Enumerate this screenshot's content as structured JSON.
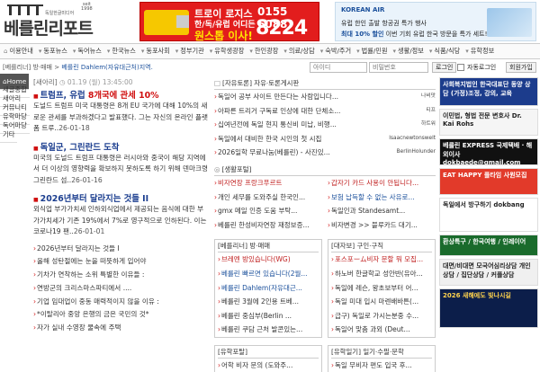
{
  "header": {
    "logo": {
      "since": "seit\n1998",
      "tag": "독일한글미디어",
      "name": "베를린리포트"
    },
    "move_ad": {
      "line1": "트로이 로지스",
      "line2": "한/독/유럽 어디든",
      "line3": "원스톱 이사!",
      "phone1": "0155 6088",
      "phone2": "8224"
    },
    "air_ad": {
      "brand": "KOREAN AIR",
      "line1": "유럽 한인 출발 항공권 특가 행사",
      "line2_prefix": "최대 10% 할인",
      "line2_suffix": " 이번 기회 유럽 한국 방문을 특가 세트!"
    }
  },
  "nav": [
    {
      "icon": "home-icon",
      "label": "이용안내"
    },
    {
      "icon": "chevron-down-icon",
      "label": "동포뉴스"
    },
    {
      "icon": "chevron-down-icon",
      "label": "독어뉴스"
    },
    {
      "icon": "chevron-down-icon",
      "label": "한국뉴스"
    },
    {
      "icon": "chevron-down-icon",
      "label": "동포사회"
    },
    {
      "icon": "chevron-down-icon",
      "label": "정부기관"
    },
    {
      "icon": "chevron-down-icon",
      "label": "유학생광장"
    },
    {
      "icon": "chevron-down-icon",
      "label": "한인광장"
    },
    {
      "icon": "chevron-down-icon",
      "label": "의료/상담"
    },
    {
      "icon": "chevron-down-icon",
      "label": "숙박/주거"
    },
    {
      "icon": "chevron-down-icon",
      "label": "법률/민원"
    },
    {
      "icon": "chevron-down-icon",
      "label": "생활/정보"
    },
    {
      "icon": "chevron-down-icon",
      "label": "식품/식당"
    },
    {
      "icon": "chevron-down-icon",
      "label": "유학정보"
    }
  ],
  "crumb": {
    "prefix": "[베를리너] 방·매매",
    "sep": " > ",
    "current": "베를린 Dahlem(자유대근처)지역.",
    "search_placeholder": "아이디",
    "password_placeholder": "비밀번호",
    "login_label": "로그인",
    "auto_login_label": "자동로그인",
    "signup_label": "회원가입"
  },
  "left_sidebar": [
    "Home",
    "새글종합",
    "새아리",
    "커뮤니티",
    "유학마당",
    "독어마당",
    "기타"
  ],
  "main": {
    "lead_head": "[새아리]",
    "lead_time": "◷ 01.19 (월) 13:45:00",
    "stories": [
      {
        "title_prefix": "트럼프, 유럽 ",
        "title_num": "8개국에 관세 10%",
        "body": "도널드 트럼프 미국 대통령은 8개 EU 국가에 대해 10%의 새로운 관세를 부과하겠다고 발표했다. 그는 자신의 온라인 플랫폼 트루..",
        "date": "26-01-18"
      },
      {
        "title_prefix": "독일군, 그린란드 도착",
        "title_num": "",
        "body": "미국의 도널드 트럼프 대통령은 러시아와 중국이 해당 지역에서 더 이상의 영향력을 확보하지 못하도록 하기 위해 덴마크령 그린란드 섬..",
        "date": "26-01-16"
      },
      {
        "title_prefix": "2026년부터 달라지는 것들 II",
        "title_num": "",
        "body": "외식업 부가가치세 인하외식업에서 제공되는 음식에 대한 부가가치세가 기존 19%에서 7%로 영구적으로 인하된다. 이는 코로나19 팬..",
        "date": "26-01-01"
      }
    ],
    "headlines": [
      "2026년부터 달라지는 것들 I",
      "올해 성탄절에는 눈을 떠뜻하게 입어야",
      "기차가 연착하는 소위 특별한 이유들 :",
      "연방군의 크리스마스파티에서 ....",
      "기업 임대업이 중동 매력적이지 않을 이유 :",
      "*이탈리아 중앙 은행의 금은 국민의 것*",
      "자가 실내 수영장 물속에 주택"
    ]
  },
  "center": {
    "free_head": "[자유토론] 자유·토론게시판",
    "free_rows": [
      {
        "text": "독일어 공부 사이트 만든다는 사람입니다...",
        "src": "나비맛"
      },
      {
        "text": "아파른 트리거 구독료 인상에 대한 단체소...",
        "src": "티프"
      },
      {
        "text": "십여년전에 독일 현지 통신비 미납, 비행...",
        "src": "하트워"
      },
      {
        "text": "독일에서 대비한 한국 시인의 첫 시집",
        "src": "Isaacnewtonswelt"
      },
      {
        "text": "2026일학 무료나눔(베를린) - 사진있...",
        "src": "BerlinHolunder"
      }
    ],
    "life_head": "[생활포털]",
    "life_left": [
      {
        "text": "비자연장 프랑크푸르트",
        "color": "red"
      },
      {
        "text": "개인 세무를 도와주실 한국인...",
        "color": ""
      },
      {
        "text": "gmx 메일 인증 도움 부탁...",
        "color": ""
      },
      {
        "text": "베를린 한성비자연장 재정보증...",
        "color": ""
      }
    ],
    "life_right": [
      {
        "text": "갑자기 카드 사용이 안됩니다...",
        "color": "red"
      },
      {
        "text": "보험 납득할 수 없는 사유로...",
        "color": "blue"
      },
      {
        "text": "독일인과 Standesamt...",
        "color": ""
      },
      {
        "text": "비자변경 >> 블루카드 대기...",
        "color": ""
      }
    ],
    "room_head": "[베를리너] 방·매매",
    "room_rows": [
      {
        "text": "브레멘 방있습니다(WG)",
        "color": "red"
      },
      {
        "text": "베를린 빠르면 있습니다(2월...",
        "color": "blue"
      },
      {
        "text": "베를린 Dahlem(자유대근...",
        "color": "blue"
      },
      {
        "text": "베를린 3월에 2인용 트베...",
        "color": ""
      },
      {
        "text": "베를린 중심부(Berlin ...",
        "color": ""
      },
      {
        "text": "베를린 쿠담 근처 발콘있는...",
        "color": ""
      }
    ],
    "job_head": "[대자보] 구인·구직",
    "job_rows": [
      {
        "text": "포스포ーム비자 문할 뭐 모집...",
        "color": "red"
      },
      {
        "text": "하노버 한글학교 성안반(유아...",
        "color": ""
      },
      {
        "text": "독일에 레슨, 왕초보부터 어...",
        "color": ""
      },
      {
        "text": "독일 미대 입시 마렌배바튼(...",
        "color": ""
      },
      {
        "text": "급구) 독일로 가시는분중 수...",
        "color": ""
      },
      {
        "text": "독일어 맞춤 과외 (Deut...",
        "color": ""
      }
    ],
    "uni_head": "[유학포탈]",
    "uni_rows": [
      {
        "text": "어학 비자 문의 (도와주...",
        "color": ""
      }
    ],
    "unimarket_head": "[유학일기] 일기·수필·문학",
    "unimarket_rows": [
      {
        "text": "독일 무비자 편도 입국 후...",
        "color": ""
      }
    ]
  },
  "right_ads": [
    {
      "text": "사회복지법인 한국대표단 동양 상담 (가정)조정, 강의, 교육",
      "bg": "#1c3c8c",
      "fg": "#fff",
      "h": 32
    },
    {
      "text": "이민법, 형법 전문 변호사 Dr. Kai Rohs",
      "bg": "#f5f5f5",
      "fg": "#222",
      "h": 30
    },
    {
      "text": "베를린 EXPRESS 국제택배 · 해외이사 dokbaede@gmail.com",
      "bg": "#111",
      "fg": "#fff",
      "h": 30
    },
    {
      "text": "EAT HAPPY 플타임 사원모집",
      "bg": "#e23a2a",
      "fg": "#fff",
      "h": 30
    },
    {
      "text": "독일에서 방구하기 dokbang",
      "bg": "#fff",
      "fg": "#222",
      "h": 38
    },
    {
      "text": "환상특구 / 한국여행 / 인레이어",
      "bg": "#1a6b2c",
      "fg": "#fff",
      "h": 24
    },
    {
      "text": "대면/비대면 모국어심리상담 개인상담 / 집단상담 / 커플상담",
      "bg": "#f0f0f0",
      "fg": "#222",
      "h": 30
    },
    {
      "text": "2026 새해에도 빛나시길",
      "bg": "#0c1e4a",
      "fg": "#ffd34d",
      "h": 44
    }
  ]
}
